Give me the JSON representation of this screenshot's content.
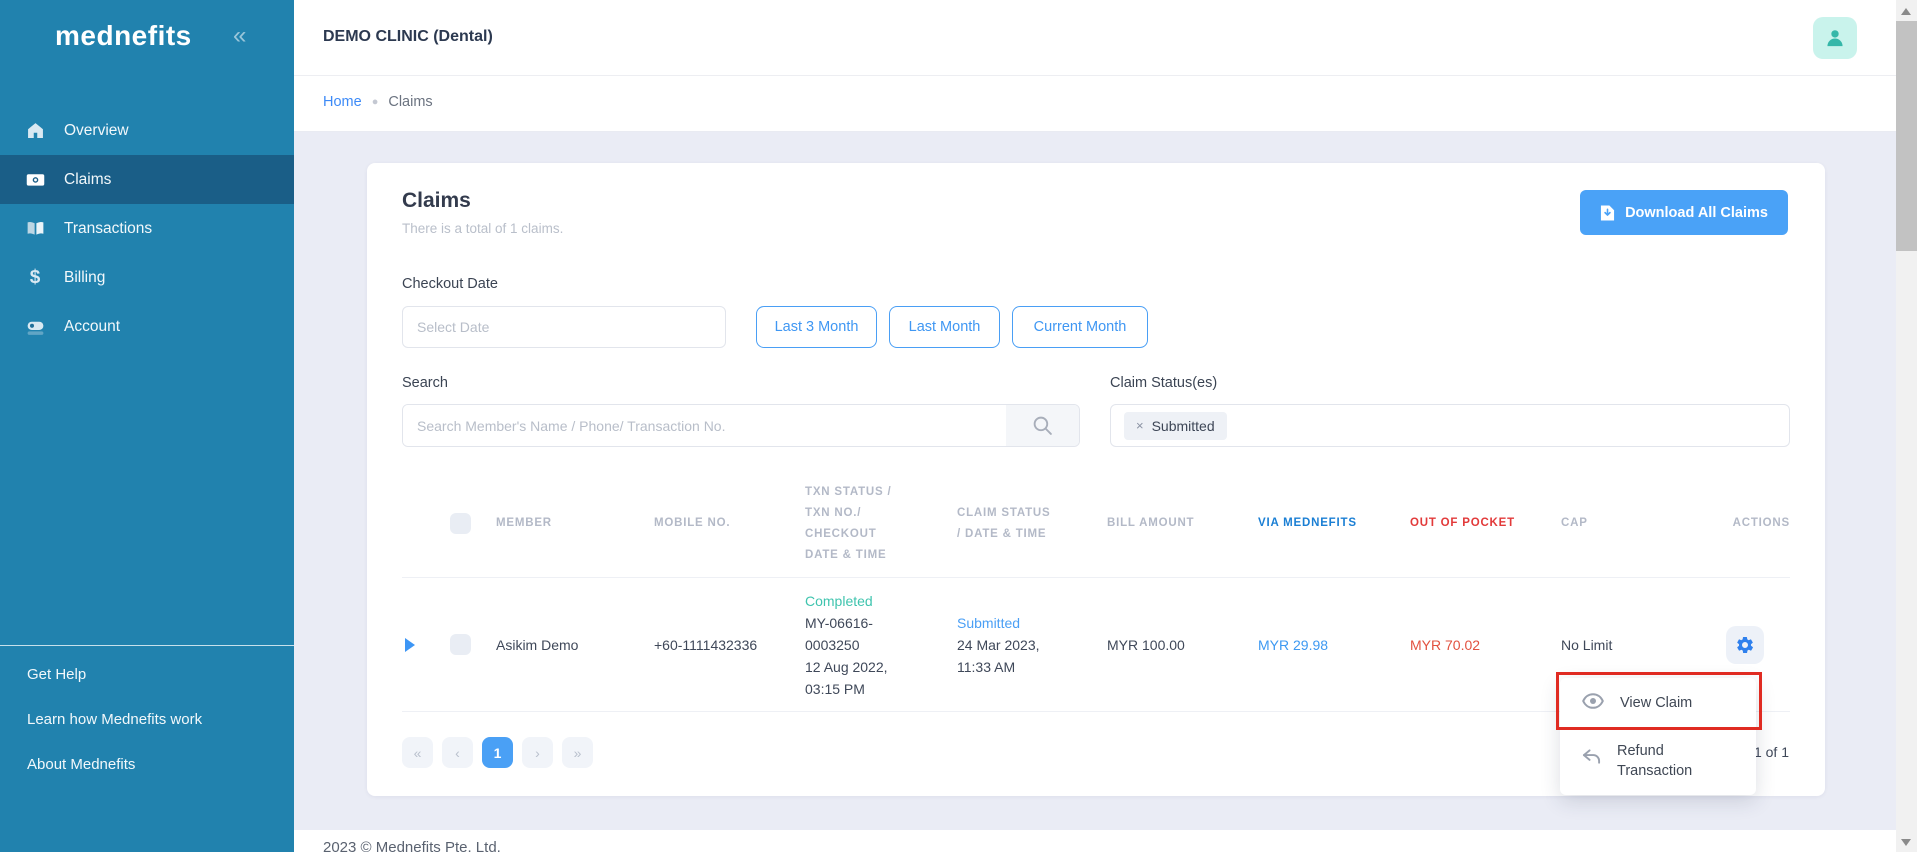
{
  "sidebar": {
    "logo": "mednefits",
    "collapse_icon": "«",
    "items": [
      {
        "label": "Overview"
      },
      {
        "label": "Claims"
      },
      {
        "label": "Transactions"
      },
      {
        "label": "Billing",
        "glyph": "$"
      },
      {
        "label": "Account"
      }
    ],
    "links": [
      "Get Help",
      "Learn how Mednefits work",
      "About Mednefits"
    ]
  },
  "header": {
    "clinic_name": "DEMO CLINIC (Dental)"
  },
  "breadcrumb": {
    "home": "Home",
    "separator": "●",
    "current": "Claims"
  },
  "panel": {
    "title": "Claims",
    "subtitle": "There is a total of 1 claims.",
    "download_label": "Download All Claims",
    "checkout_label": "Checkout Date",
    "date_placeholder": "Select Date",
    "quick_filters": [
      "Last 3 Month",
      "Last Month",
      "Current Month"
    ],
    "search_label": "Search",
    "search_placeholder": "Search Member's Name / Phone/ Transaction No.",
    "status_label": "Claim Status(es)",
    "status_tag": {
      "close": "×",
      "label": "Submitted"
    }
  },
  "table": {
    "columns": {
      "member": "MEMBER",
      "mobile": "MOBILE NO.",
      "txn": [
        "TXN STATUS /",
        "TXN NO./",
        "CHECKOUT",
        "DATE & TIME"
      ],
      "claim": [
        "CLAIM STATUS",
        "/ DATE & TIME"
      ],
      "bill": "BILL AMOUNT",
      "via": "VIA MEDNEFITS",
      "oop": "OUT OF POCKET",
      "cap": "CAP",
      "actions": "ACTIONS"
    },
    "row": {
      "member": "Asikim Demo",
      "mobile": "+60-1111432336",
      "txn_status": "Completed",
      "txn_no_line1": "MY-06616-",
      "txn_no_line2": "0003250",
      "checkout_date": "12 Aug 2022,",
      "checkout_time": "03:15 PM",
      "claim_status": "Submitted",
      "claim_date": "24 Mar 2023,",
      "claim_time": "11:33 AM",
      "bill": "MYR 100.00",
      "via": "MYR 29.98",
      "oop": "MYR 70.02",
      "cap": "No Limit"
    }
  },
  "menu": {
    "view_claim": "View Claim",
    "refund_line1": "Refund",
    "refund_line2": "Transaction"
  },
  "pagination": {
    "first": "«",
    "prev": "‹",
    "page": "1",
    "next": "›",
    "last": "»",
    "info": "1 of 1"
  },
  "footer": {
    "copyright": "2023 ©  Mednefits Pte. Ltd."
  },
  "colors": {
    "sidebar_teal": "#2182ae",
    "sidebar_active": "#1a5e87",
    "accent_blue": "#4aa2f7",
    "link_blue": "#3d96f5",
    "header_via_blue": "#1b7fd4",
    "status_red": "#e23a3a",
    "status_teal": "#3fc4ae",
    "annotation_red": "#e02b22",
    "avatar_teal": "#35b7a9"
  }
}
